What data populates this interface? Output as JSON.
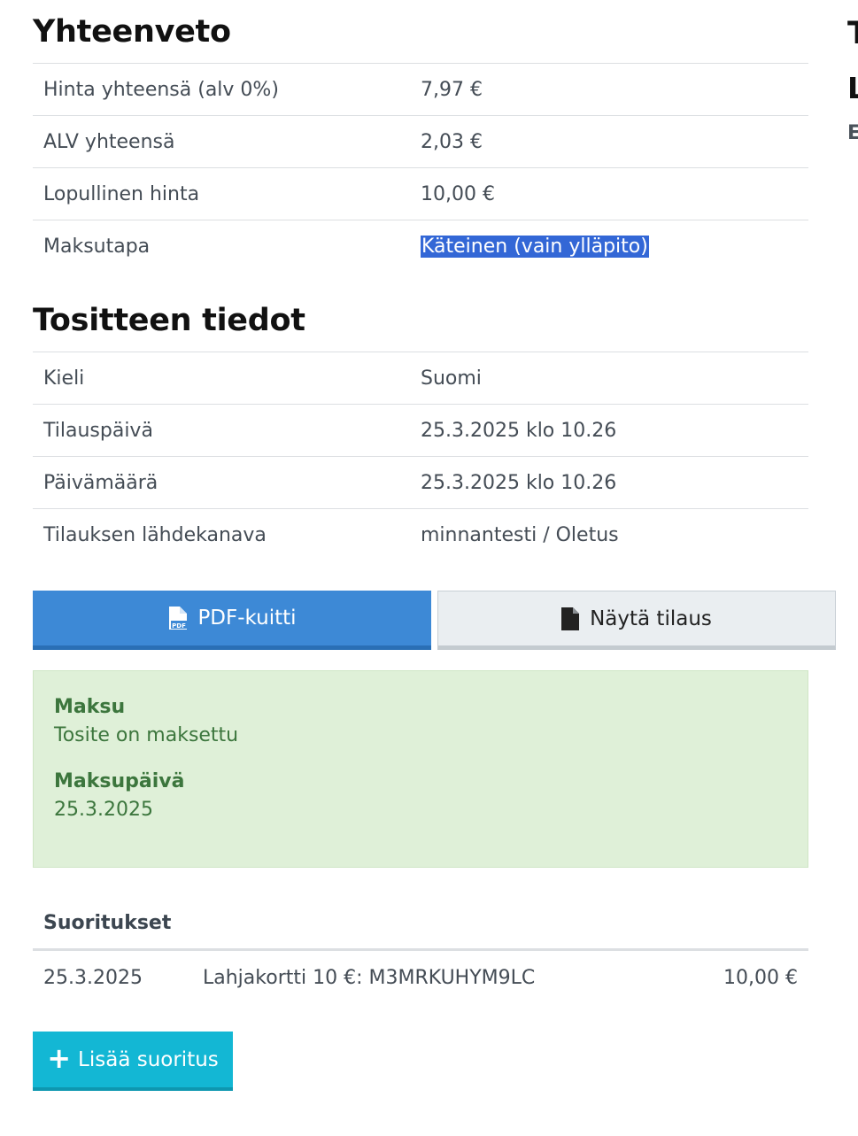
{
  "summary": {
    "title": "Yhteenveto",
    "rows": [
      {
        "label": "Hinta yhteensä (alv 0%)",
        "value": "7,97 €"
      },
      {
        "label": "ALV yhteensä",
        "value": "2,03 €"
      },
      {
        "label": "Lopullinen hinta",
        "value": "10,00 €"
      },
      {
        "label": "Maksutapa",
        "value": "Käteinen (vain ylläpito)"
      }
    ]
  },
  "voucher": {
    "title": "Tositteen tiedot",
    "rows": [
      {
        "label": "Kieli",
        "value": "Suomi"
      },
      {
        "label": "Tilauspäivä",
        "value": "25.3.2025 klo 10.26"
      },
      {
        "label": "Päivämäärä",
        "value": "25.3.2025 klo 10.26"
      },
      {
        "label": "Tilauksen lähdekanava",
        "value": "minnantesti / Oletus"
      }
    ]
  },
  "right_column": {
    "t": "T",
    "l": "L",
    "e": "E"
  },
  "actions": {
    "pdf_label": "PDF-kuitti",
    "pdf_icon": "file-pdf-icon",
    "order_label": "Näytä tilaus",
    "order_icon": "file-icon"
  },
  "payment_status": {
    "label": "Maksu",
    "value": "Tosite on maksettu",
    "date_label": "Maksupäivä",
    "date_value": "25.3.2025"
  },
  "payments": {
    "header": "Suoritukset",
    "rows": [
      {
        "date": "25.3.2025",
        "description": "Lahjakortti 10 €: M3MRKUHYM9LC",
        "amount": "10,00 €"
      }
    ],
    "add_label": "Lisää suoritus"
  },
  "colors": {
    "primary": "#3d89d6",
    "info": "#13b7d4",
    "success_bg": "#dff0d8",
    "success_text": "#3c763d",
    "selection": "#3367d6"
  }
}
